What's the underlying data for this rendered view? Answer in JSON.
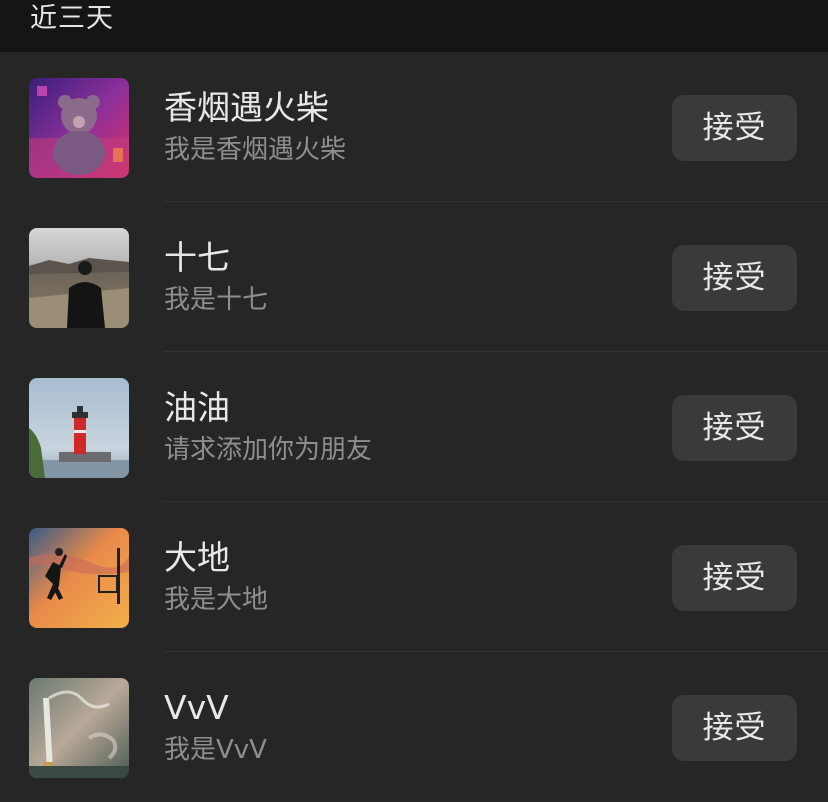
{
  "header": {
    "title": "近三天"
  },
  "requests": [
    {
      "name": "香烟遇火柴",
      "message": "我是香烟遇火柴",
      "action": "接受",
      "avatar": "teddy-bear-photo"
    },
    {
      "name": "十七",
      "message": "我是十七",
      "action": "接受",
      "avatar": "man-back-view-photo"
    },
    {
      "name": "油油",
      "message": "请求添加你为朋友",
      "action": "接受",
      "avatar": "lighthouse-photo"
    },
    {
      "name": "大地",
      "message": "我是大地",
      "action": "接受",
      "avatar": "basketball-sunset-photo"
    },
    {
      "name": "VvV",
      "message": "我是VvV",
      "action": "接受",
      "avatar": "cigarette-photo"
    }
  ],
  "colors": {
    "background": "#262626",
    "header_background": "#151515",
    "button_background": "#3a3a3a",
    "primary_text": "#e8e8e8",
    "secondary_text": "#8e8e8e"
  }
}
